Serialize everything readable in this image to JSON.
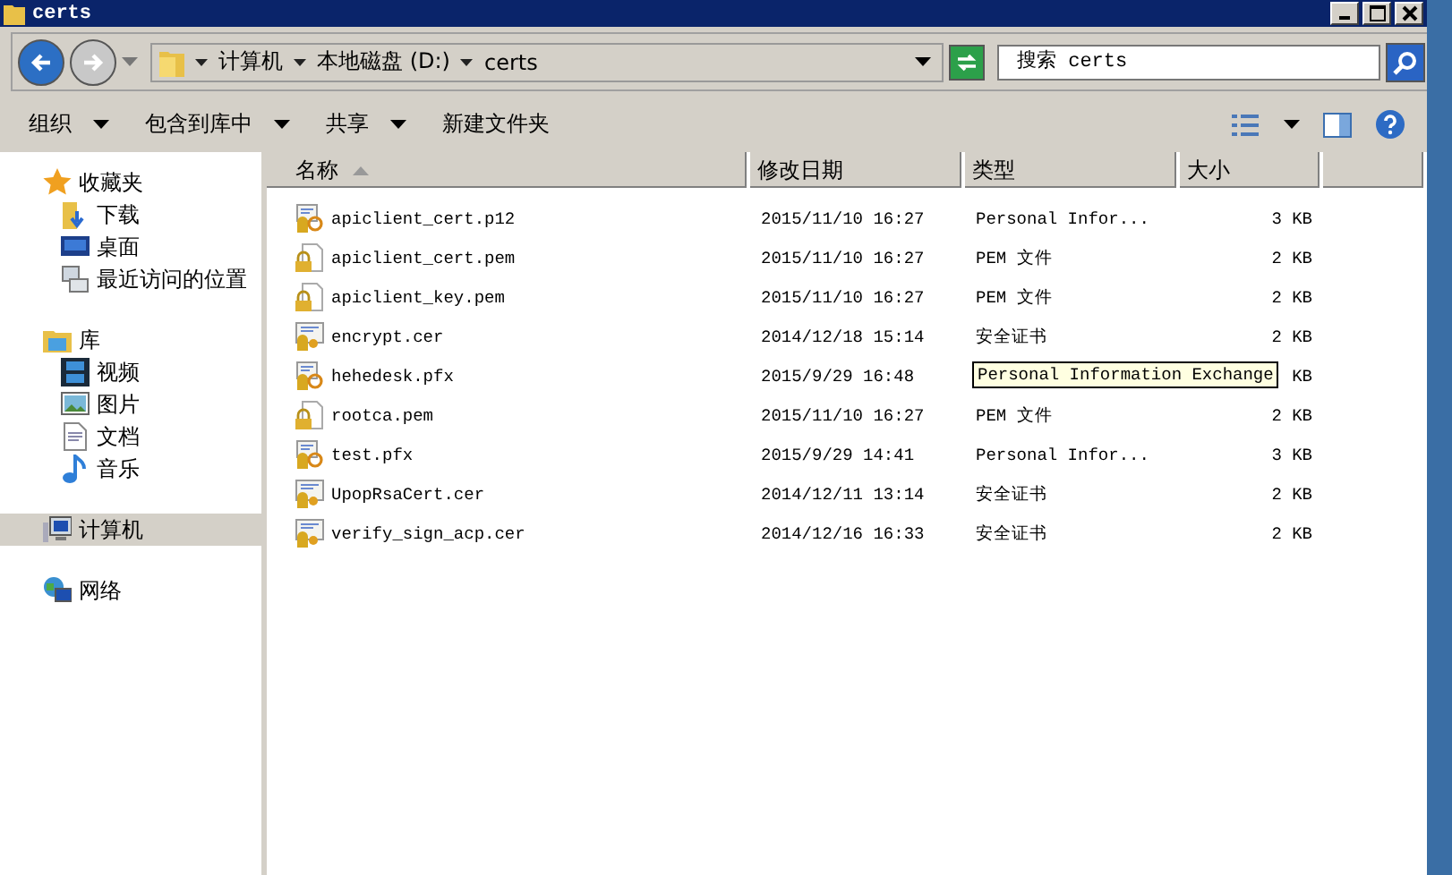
{
  "window": {
    "title": "certs"
  },
  "address": {
    "crumbs": [
      "计算机",
      "本地磁盘 (D:)",
      "certs"
    ]
  },
  "search": {
    "placeholder": "搜索 certs"
  },
  "toolbar": {
    "buttons": [
      {
        "label": "组织",
        "dropdown": true
      },
      {
        "label": "包含到库中",
        "dropdown": true
      },
      {
        "label": "共享",
        "dropdown": true
      },
      {
        "label": "新建文件夹",
        "dropdown": false
      }
    ]
  },
  "sidebar": {
    "groups": [
      {
        "label": "收藏夹",
        "kind": "star",
        "selected": false,
        "children": [
          {
            "label": "下载",
            "kind": "download",
            "selected": false
          },
          {
            "label": "桌面",
            "kind": "desktop",
            "selected": false
          },
          {
            "label": "最近访问的位置",
            "kind": "recent",
            "selected": false
          }
        ]
      },
      {
        "label": "库",
        "kind": "library",
        "selected": false,
        "children": [
          {
            "label": "视频",
            "kind": "video",
            "selected": false
          },
          {
            "label": "图片",
            "kind": "image",
            "selected": false
          },
          {
            "label": "文档",
            "kind": "document",
            "selected": false
          },
          {
            "label": "音乐",
            "kind": "music",
            "selected": false
          }
        ]
      },
      {
        "label": "计算机",
        "kind": "computer",
        "selected": true
      },
      {
        "label": "网络",
        "kind": "network",
        "selected": false
      }
    ]
  },
  "table": {
    "columns": [
      "名称",
      "修改日期",
      "类型",
      "大小"
    ],
    "rows": [
      {
        "kind": "pfx",
        "name": "apiclient_cert.p12",
        "date": "2015/11/10 16:27",
        "type": "Personal Infor...",
        "size": "3 KB"
      },
      {
        "kind": "pem",
        "name": "apiclient_cert.pem",
        "date": "2015/11/10 16:27",
        "type": "PEM 文件",
        "size": "2 KB"
      },
      {
        "kind": "pem",
        "name": "apiclient_key.pem",
        "date": "2015/11/10 16:27",
        "type": "PEM 文件",
        "size": "2 KB"
      },
      {
        "kind": "cer",
        "name": "encrypt.cer",
        "date": "2014/12/18 15:14",
        "type": "安全证书",
        "size": "2 KB"
      },
      {
        "kind": "pfx",
        "name": "hehedesk.pfx",
        "date": "2015/9/29 16:48",
        "size": "KB"
      },
      {
        "kind": "pem",
        "name": "rootca.pem",
        "date": "2015/11/10 16:27",
        "type": "PEM 文件",
        "size": "2 KB"
      },
      {
        "kind": "pfx",
        "name": "test.pfx",
        "date": "2015/9/29 14:41",
        "type": "Personal Infor...",
        "size": "3 KB"
      },
      {
        "kind": "cer",
        "name": "UpopRsaCert.cer",
        "date": "2014/12/11 13:14",
        "type": "安全证书",
        "size": "2 KB"
      },
      {
        "kind": "cer",
        "name": "verify_sign_acp.cer",
        "date": "2014/12/16 16:33",
        "type": "安全证书",
        "size": "2 KB"
      }
    ]
  },
  "tooltip": {
    "text": "Personal Information Exchange"
  }
}
